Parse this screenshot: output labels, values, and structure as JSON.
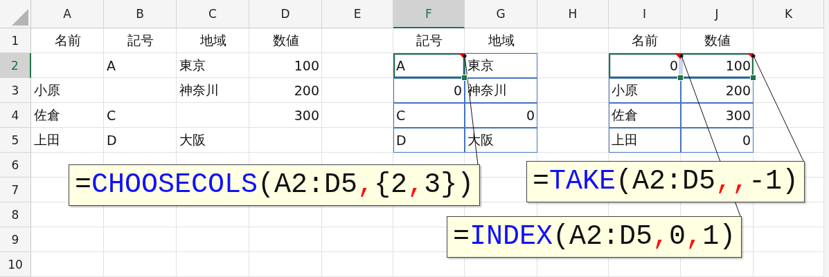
{
  "columns": [
    {
      "label": "A",
      "selected": false
    },
    {
      "label": "B",
      "selected": false
    },
    {
      "label": "C",
      "selected": false
    },
    {
      "label": "D",
      "selected": false
    },
    {
      "label": "E",
      "selected": false
    },
    {
      "label": "F",
      "selected": true
    },
    {
      "label": "G",
      "selected": false
    },
    {
      "label": "H",
      "selected": false
    },
    {
      "label": "I",
      "selected": false
    },
    {
      "label": "J",
      "selected": false
    },
    {
      "label": "K",
      "selected": false
    }
  ],
  "rows": [
    {
      "label": "1",
      "selected": false,
      "cells": [
        {
          "text": "名前",
          "kind": "header",
          "selected": false,
          "note": false,
          "in_range": false
        },
        {
          "text": "記号",
          "kind": "header",
          "selected": false,
          "note": false,
          "in_range": false
        },
        {
          "text": "地域",
          "kind": "header",
          "selected": false,
          "note": false,
          "in_range": false
        },
        {
          "text": "数値",
          "kind": "header",
          "selected": false,
          "note": false,
          "in_range": false
        },
        {
          "selected": false,
          "note": false,
          "in_range": false
        },
        {
          "text": "記号",
          "kind": "header",
          "selected": false,
          "note": false,
          "in_range": false
        },
        {
          "text": "地域",
          "kind": "header",
          "selected": false,
          "note": false,
          "in_range": false
        },
        {
          "selected": false,
          "note": false,
          "in_range": false
        },
        {
          "text": "名前",
          "kind": "header",
          "selected": false,
          "note": false,
          "in_range": false
        },
        {
          "text": "数値",
          "kind": "header",
          "selected": false,
          "note": false,
          "in_range": false
        },
        {
          "selected": false,
          "note": false,
          "in_range": false
        }
      ]
    },
    {
      "label": "2",
      "selected": true,
      "cells": [
        {
          "selected": false,
          "note": false,
          "in_range": false
        },
        {
          "text": "A",
          "kind": "text",
          "selected": false,
          "note": false,
          "in_range": false
        },
        {
          "text": "東京",
          "kind": "text",
          "selected": false,
          "note": false,
          "in_range": false
        },
        {
          "text": "100",
          "kind": "number",
          "selected": false,
          "note": false,
          "in_range": false
        },
        {
          "selected": false,
          "note": false,
          "in_range": false
        },
        {
          "text": "A",
          "kind": "text",
          "selected": true,
          "note": true,
          "in_range": true
        },
        {
          "text": "東京",
          "kind": "text",
          "selected": false,
          "note": false,
          "in_range": true
        },
        {
          "selected": false,
          "note": false,
          "in_range": false
        },
        {
          "text": "0",
          "kind": "number",
          "selected": true,
          "note": true,
          "in_range": true
        },
        {
          "text": "100",
          "kind": "number",
          "selected": true,
          "note": true,
          "in_range": true
        },
        {
          "selected": false,
          "note": false,
          "in_range": false
        }
      ]
    },
    {
      "label": "3",
      "selected": false,
      "cells": [
        {
          "text": "小原",
          "kind": "text",
          "selected": false,
          "note": false,
          "in_range": false
        },
        {
          "selected": false,
          "note": false,
          "in_range": false
        },
        {
          "text": "神奈川",
          "kind": "text",
          "selected": false,
          "note": false,
          "in_range": false
        },
        {
          "text": "200",
          "kind": "number",
          "selected": false,
          "note": false,
          "in_range": false
        },
        {
          "selected": false,
          "note": false,
          "in_range": false
        },
        {
          "text": "0",
          "kind": "number",
          "selected": false,
          "note": false,
          "in_range": true
        },
        {
          "text": "神奈川",
          "kind": "text",
          "selected": false,
          "note": false,
          "in_range": true
        },
        {
          "selected": false,
          "note": false,
          "in_range": false
        },
        {
          "text": "小原",
          "kind": "text",
          "selected": false,
          "note": false,
          "in_range": true
        },
        {
          "text": "200",
          "kind": "number",
          "selected": false,
          "note": false,
          "in_range": true
        },
        {
          "selected": false,
          "note": false,
          "in_range": false
        }
      ]
    },
    {
      "label": "4",
      "selected": false,
      "cells": [
        {
          "text": "佐倉",
          "kind": "text",
          "selected": false,
          "note": false,
          "in_range": false
        },
        {
          "text": "C",
          "kind": "text",
          "selected": false,
          "note": false,
          "in_range": false
        },
        {
          "selected": false,
          "note": false,
          "in_range": false
        },
        {
          "text": "300",
          "kind": "number",
          "selected": false,
          "note": false,
          "in_range": false
        },
        {
          "selected": false,
          "note": false,
          "in_range": false
        },
        {
          "text": "C",
          "kind": "text",
          "selected": false,
          "note": false,
          "in_range": true
        },
        {
          "text": "0",
          "kind": "number",
          "selected": false,
          "note": false,
          "in_range": true
        },
        {
          "selected": false,
          "note": false,
          "in_range": false
        },
        {
          "text": "佐倉",
          "kind": "text",
          "selected": false,
          "note": false,
          "in_range": true
        },
        {
          "text": "300",
          "kind": "number",
          "selected": false,
          "note": false,
          "in_range": true
        },
        {
          "selected": false,
          "note": false,
          "in_range": false
        }
      ]
    },
    {
      "label": "5",
      "selected": false,
      "cells": [
        {
          "text": "上田",
          "kind": "text",
          "selected": false,
          "note": false,
          "in_range": false
        },
        {
          "text": "D",
          "kind": "text",
          "selected": false,
          "note": false,
          "in_range": false
        },
        {
          "text": "大阪",
          "kind": "text",
          "selected": false,
          "note": false,
          "in_range": false
        },
        {
          "selected": false,
          "note": false,
          "in_range": false
        },
        {
          "selected": false,
          "note": false,
          "in_range": false
        },
        {
          "text": "D",
          "kind": "text",
          "selected": false,
          "note": false,
          "in_range": true
        },
        {
          "text": "大阪",
          "kind": "text",
          "selected": false,
          "note": false,
          "in_range": true
        },
        {
          "selected": false,
          "note": false,
          "in_range": false
        },
        {
          "text": "上田",
          "kind": "text",
          "selected": false,
          "note": false,
          "in_range": true
        },
        {
          "text": "0",
          "kind": "number",
          "selected": false,
          "note": false,
          "in_range": true
        },
        {
          "selected": false,
          "note": false,
          "in_range": false
        }
      ]
    },
    {
      "label": "6",
      "selected": false
    },
    {
      "label": "7",
      "selected": false
    },
    {
      "label": "8",
      "selected": false
    },
    {
      "label": "9",
      "selected": false
    },
    {
      "label": "10",
      "selected": false
    }
  ],
  "notes": [
    {
      "segments": [
        {
          "kind": "text",
          "text": "="
        },
        {
          "kind": "function",
          "text": "CHOOSECOLS"
        },
        {
          "kind": "text",
          "text": "(A2:D5"
        },
        {
          "kind": "separator",
          "text": ","
        },
        {
          "kind": "text",
          "text": "{2"
        },
        {
          "kind": "separator",
          "text": ","
        },
        {
          "kind": "text",
          "text": "3})"
        }
      ]
    },
    {
      "segments": [
        {
          "kind": "text",
          "text": "="
        },
        {
          "kind": "function",
          "text": "TAKE"
        },
        {
          "kind": "text",
          "text": "(A2:D5"
        },
        {
          "kind": "separator",
          "text": ","
        },
        {
          "kind": "separator",
          "text": ","
        },
        {
          "kind": "text",
          "text": "-1)"
        }
      ]
    },
    {
      "segments": [
        {
          "kind": "text",
          "text": "="
        },
        {
          "kind": "function",
          "text": "INDEX"
        },
        {
          "kind": "text",
          "text": "(A2:D5"
        },
        {
          "kind": "separator",
          "text": ","
        },
        {
          "kind": "text",
          "text": "0"
        },
        {
          "kind": "separator",
          "text": ","
        },
        {
          "kind": "text",
          "text": "1)"
        }
      ]
    }
  ]
}
